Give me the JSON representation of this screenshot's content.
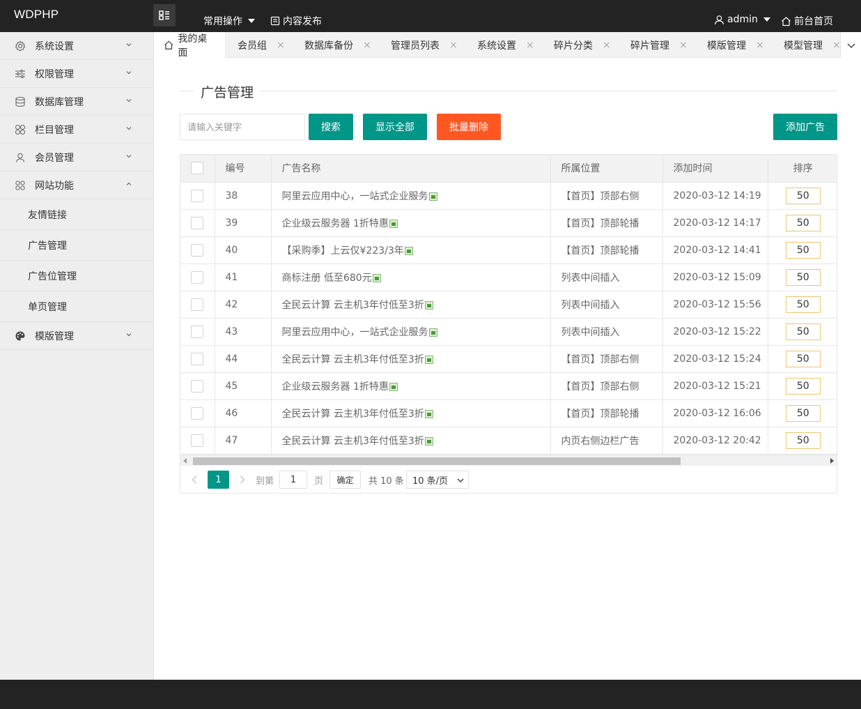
{
  "app": {
    "logo": "WDPHP"
  },
  "header": {
    "nav": [
      {
        "label": "常用操作",
        "icon": "caret-down-icon"
      },
      {
        "label": "内容发布",
        "icon": "document-icon"
      }
    ],
    "user": "admin",
    "frontend_link": "前台首页"
  },
  "sidebar": {
    "items": [
      {
        "label": "系统设置",
        "icon": "gear-icon",
        "expanded": false
      },
      {
        "label": "权限管理",
        "icon": "sliders-icon",
        "expanded": false
      },
      {
        "label": "数据库管理",
        "icon": "database-icon",
        "expanded": false
      },
      {
        "label": "栏目管理",
        "icon": "grid-icon",
        "expanded": false
      },
      {
        "label": "会员管理",
        "icon": "user-icon",
        "expanded": false
      },
      {
        "label": "网站功能",
        "icon": "apps-icon",
        "expanded": true,
        "children": [
          "友情链接",
          "广告管理",
          "广告位管理",
          "单页管理"
        ]
      },
      {
        "label": "模版管理",
        "icon": "palette-icon",
        "expanded": false
      }
    ]
  },
  "tabs": [
    {
      "label": "我的桌面",
      "icon": "home-icon",
      "closable": false
    },
    {
      "label": "会员组",
      "closable": true
    },
    {
      "label": "数据库备份",
      "closable": true
    },
    {
      "label": "管理员列表",
      "closable": true
    },
    {
      "label": "系统设置",
      "closable": true
    },
    {
      "label": "碎片分类",
      "closable": true
    },
    {
      "label": "碎片管理",
      "closable": true
    },
    {
      "label": "模版管理",
      "closable": true
    },
    {
      "label": "模型管理",
      "closable": true
    }
  ],
  "tab_close_glyph": "×",
  "main": {
    "title": "广告管理",
    "search": {
      "placeholder": "请输入关键字",
      "value": ""
    },
    "buttons": {
      "search": "搜索",
      "show_all": "显示全部",
      "batch_delete": "批量删除",
      "add": "添加广告"
    }
  },
  "table": {
    "headers": [
      "",
      "编号",
      "广告名称",
      "所属位置",
      "添加时间",
      "排序"
    ],
    "rows": [
      {
        "id": "38",
        "name": "阿里云应用中心，一站式企业服务",
        "position": "【首页】顶部右侧",
        "time": "2020-03-12 14:19",
        "sort": "50"
      },
      {
        "id": "39",
        "name": "企业级云服务器 1折特惠",
        "position": "【首页】顶部轮播",
        "time": "2020-03-12 14:17",
        "sort": "50"
      },
      {
        "id": "40",
        "name": "【采购季】上云仅¥223/3年",
        "position": "【首页】顶部轮播",
        "time": "2020-03-12 14:41",
        "sort": "50"
      },
      {
        "id": "41",
        "name": "商标注册 低至680元",
        "position": "列表中间插入",
        "time": "2020-03-12 15:09",
        "sort": "50"
      },
      {
        "id": "42",
        "name": "全民云计算 云主机3年付低至3折",
        "position": "列表中间插入",
        "time": "2020-03-12 15:56",
        "sort": "50"
      },
      {
        "id": "43",
        "name": "阿里云应用中心，一站式企业服务",
        "position": "列表中间插入",
        "time": "2020-03-12 15:22",
        "sort": "50"
      },
      {
        "id": "44",
        "name": "全民云计算 云主机3年付低至3折",
        "position": "【首页】顶部右侧",
        "time": "2020-03-12 15:24",
        "sort": "50"
      },
      {
        "id": "45",
        "name": "企业级云服务器 1折特惠",
        "position": "【首页】顶部右侧",
        "time": "2020-03-12 15:21",
        "sort": "50"
      },
      {
        "id": "46",
        "name": "全民云计算 云主机3年付低至3折",
        "position": "【首页】顶部轮播",
        "time": "2020-03-12 16:06",
        "sort": "50"
      },
      {
        "id": "47",
        "name": "全民云计算 云主机3年付低至3折",
        "position": "内页右侧边栏广告",
        "time": "2020-03-12 20:42",
        "sort": "50"
      }
    ]
  },
  "pagination": {
    "current_page": "1",
    "goto_label": "到第",
    "goto_value": "1",
    "page_unit": "页",
    "confirm": "确定",
    "total": "共 10 条",
    "page_size": "10 条/页"
  },
  "colors": {
    "primary": "#009688",
    "danger": "#ff5722",
    "header_bg": "#232323",
    "sidebar_bg": "#eeeeee"
  }
}
